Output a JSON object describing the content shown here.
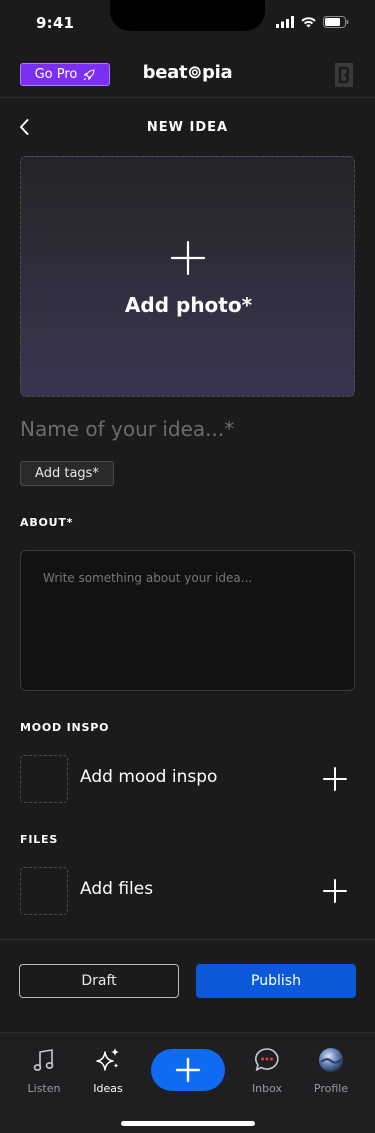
{
  "status": {
    "time": "9:41"
  },
  "header": {
    "go_pro_label": "Go Pro",
    "logo_text": "beat⊚pia"
  },
  "page": {
    "title": "NEW IDEA"
  },
  "photo": {
    "label": "Add photo*"
  },
  "name_field": {
    "placeholder": "Name of your idea...*"
  },
  "tags": {
    "label": "Add tags*"
  },
  "about": {
    "label": "ABOUT*",
    "placeholder": "Write something about your idea..."
  },
  "mood": {
    "label": "MOOD INSPO",
    "add_label": "Add mood inspo"
  },
  "files": {
    "label": "FILES",
    "add_label": "Add files"
  },
  "actions": {
    "draft_label": "Draft",
    "publish_label": "Publish"
  },
  "tabs": [
    {
      "label": "Listen",
      "icon": "music-note-icon"
    },
    {
      "label": "Ideas",
      "icon": "sparkles-icon"
    },
    {
      "label": "Inbox",
      "icon": "chat-bubble-icon"
    },
    {
      "label": "Profile",
      "icon": "avatar"
    }
  ],
  "colors": {
    "accent": "#0f6cf2",
    "publish": "#0b58d8",
    "go_pro": "#7b2ff2",
    "background": "#1b1b1c",
    "inbox_dots": "#e0423a"
  }
}
